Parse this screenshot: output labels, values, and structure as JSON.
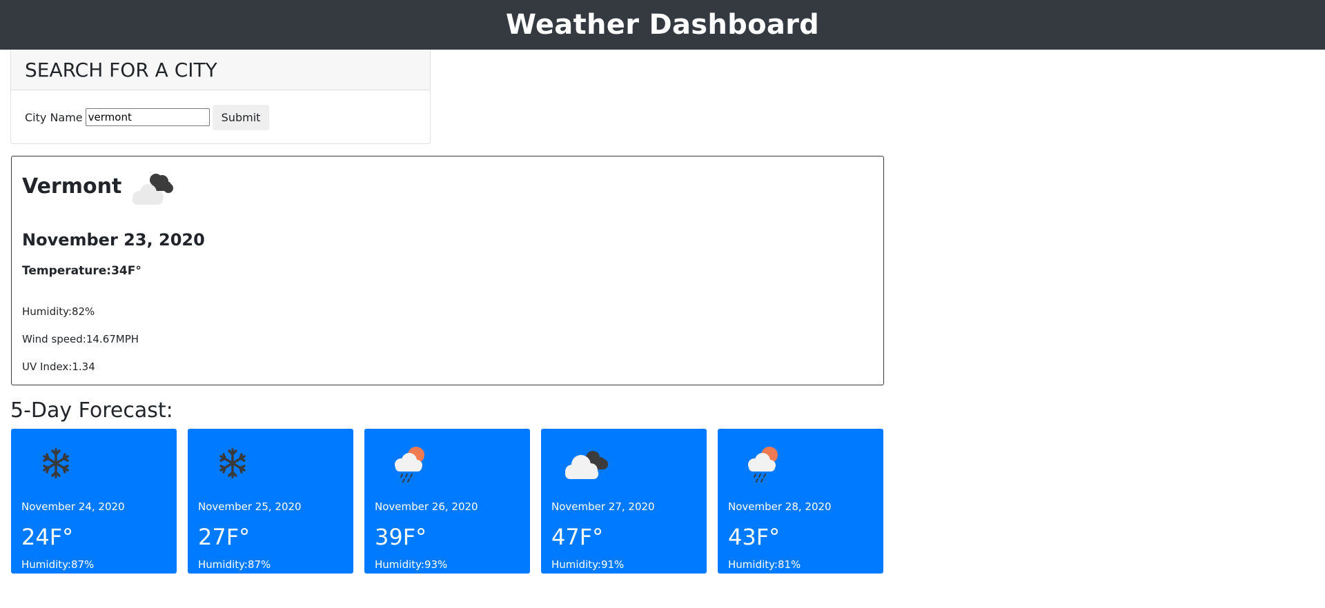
{
  "header": {
    "title": "Weather Dashboard"
  },
  "search": {
    "heading": "SEARCH FOR A CITY",
    "label": "City Name",
    "value": "vermont",
    "submit_label": "Submit"
  },
  "current": {
    "city": "Vermont",
    "icon": "partly-cloudy-dark-icon",
    "date": "November 23, 2020",
    "temperature": "Temperature:34F°",
    "humidity": "Humidity:82%",
    "wind": "Wind speed:14.67MPH",
    "uv": "UV Index:1.34"
  },
  "forecast": {
    "title": "5-Day Forecast:",
    "accent_color": "#007bff",
    "days": [
      {
        "date": "November 24, 2020",
        "temp": "24F°",
        "humidity": "Humidity:87%",
        "icon": "snowflake-icon"
      },
      {
        "date": "November 25, 2020",
        "temp": "27F°",
        "humidity": "Humidity:87%",
        "icon": "snowflake-icon"
      },
      {
        "date": "November 26, 2020",
        "temp": "39F°",
        "humidity": "Humidity:93%",
        "icon": "sun-rain-cloud-icon"
      },
      {
        "date": "November 27, 2020",
        "temp": "47F°",
        "humidity": "Humidity:91%",
        "icon": "cloudy-icon"
      },
      {
        "date": "November 28, 2020",
        "temp": "43F°",
        "humidity": "Humidity:81%",
        "icon": "sun-rain-cloud-icon"
      }
    ]
  }
}
